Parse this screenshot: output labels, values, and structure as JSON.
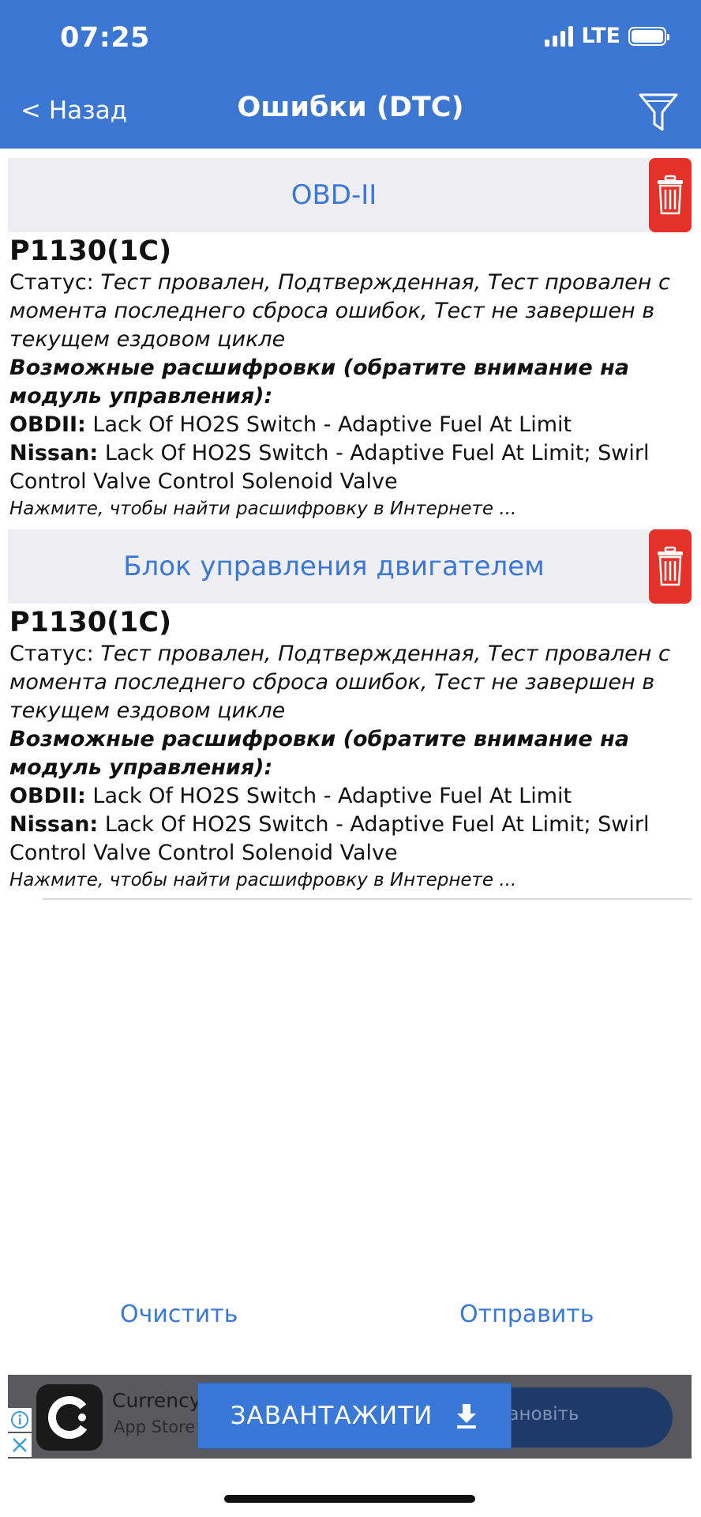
{
  "status_bar": {
    "time": "07:25",
    "network": "LTE"
  },
  "header": {
    "back_label": "< Назад",
    "title": "Ошибки (DTC)"
  },
  "sections": [
    {
      "title": "OBD-II",
      "code": "P1130(1C)",
      "status_label": "Статус: ",
      "status_value": "Тест провален, Подтвержденная, Тест провален с момента последнего сброса ошибок, Тест не завершен в текущем ездовом цикле",
      "decodings_heading": "Возможные расшифровки (обратите внимание на модуль управления):",
      "decodings": [
        {
          "label": "OBDII:",
          "value": " Lack Of HO2S Switch - Adaptive Fuel At Limit"
        },
        {
          "label": "Nissan:",
          "value": " Lack Of HO2S Switch - Adaptive Fuel At Limit; Swirl Control Valve Control Solenoid Valve"
        }
      ],
      "search_hint": "Нажмите, чтобы найти расшифровку в Интернете ..."
    },
    {
      "title": "Блок управления двигателем",
      "code": "P1130(1C)",
      "status_label": "Статус: ",
      "status_value": "Тест провален, Подтвержденная, Тест провален с момента последнего сброса ошибок, Тест не завершен в текущем ездовом цикле",
      "decodings_heading": "Возможные расшифровки (обратите внимание на модуль управления):",
      "decodings": [
        {
          "label": "OBDII:",
          "value": " Lack Of HO2S Switch - Adaptive Fuel At Limit"
        },
        {
          "label": "Nissan:",
          "value": " Lack Of HO2S Switch - Adaptive Fuel At Limit; Swirl Control Valve Control Solenoid Valve"
        }
      ],
      "search_hint": "Нажмите, чтобы найти расшифровку в Интернете ..."
    }
  ],
  "actions": {
    "clear_label": "Очистить",
    "send_label": "Отправить"
  },
  "ad": {
    "app_name": "Currency",
    "app_store": "App Store",
    "install_label": "тановіть",
    "download_label": "ЗАВАНТАЖИТИ"
  },
  "colors": {
    "header": "#3a76d2",
    "accent": "#3a78d8",
    "delete": "#e4322b",
    "section_bg": "#efeff3"
  }
}
